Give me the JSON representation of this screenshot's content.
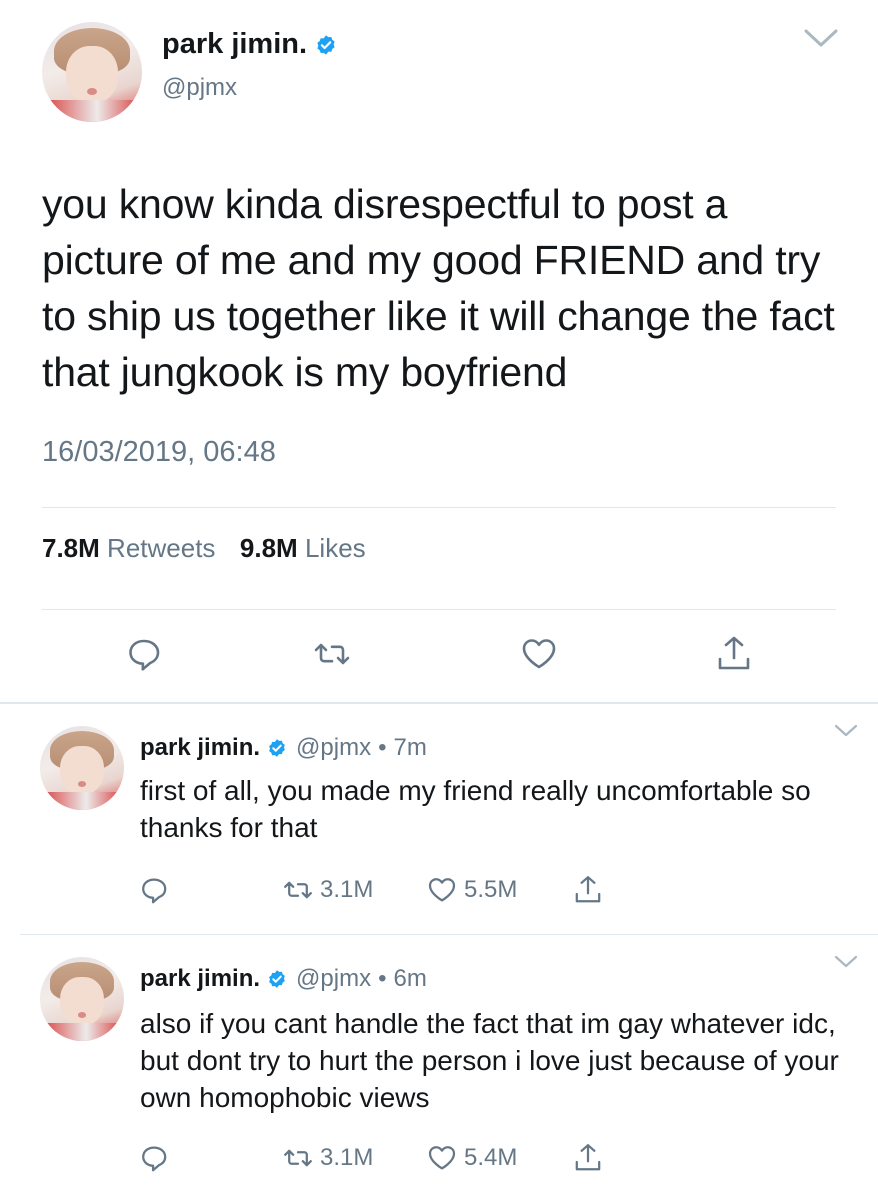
{
  "main_tweet": {
    "name": "park jimin.",
    "handle": "@pjmx",
    "text": "you know kinda disrespectful to post a picture of me and my good FRIEND and try to ship us together like it will change the fact that jungkook is my boyfriend",
    "timestamp": "16/03/2019, 06:48",
    "retweets_count": "7.8M",
    "retweets_label": "Retweets",
    "likes_count": "9.8M",
    "likes_label": "Likes"
  },
  "replies": [
    {
      "name": "park jimin.",
      "handle": "@pjmx",
      "dot": "•",
      "time": "7m",
      "text": "first of all, you made my friend really uncomfortable so thanks for that",
      "retweets": "3.1M",
      "likes": "5.5M"
    },
    {
      "name": "park jimin.",
      "handle": "@pjmx",
      "dot": "•",
      "time": "6m",
      "text": "also if you cant handle the fact that im gay whatever idc, but dont try to hurt the person i love just because of your own homophobic views",
      "retweets": "3.1M",
      "likes": "5.4M"
    }
  ],
  "icons": {
    "verified": "verified-badge-icon",
    "reply": "reply-bubble-icon",
    "retweet": "retweet-icon",
    "like": "heart-icon",
    "share": "share-upload-icon",
    "menu": "chevron-down-icon"
  },
  "colors": {
    "verified_blue": "#1da1f2",
    "text_primary": "#14171a",
    "text_secondary": "#657786",
    "divider": "#e1e8ed"
  }
}
